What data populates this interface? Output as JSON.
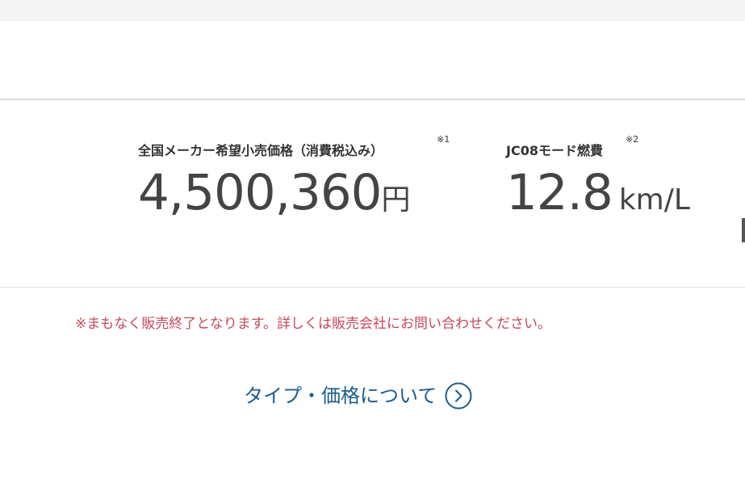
{
  "price": {
    "label": "全国メーカー希望小売価格（消費税込み）",
    "note": "※1",
    "value": "4,500,360",
    "unit": "円"
  },
  "fuel": {
    "label": "JC08モード燃費",
    "note": "※2",
    "value": "12.8",
    "unit": "km/L"
  },
  "notice": "※まもなく販売終了となります。詳しくは販売会社にお問い合わせください。",
  "type_price_link": {
    "label": "タイプ・価格について",
    "icon": "chevron-right-circle-icon"
  },
  "colors": {
    "notice": "#c8485a",
    "link": "#1a5d8f",
    "text": "#333333"
  }
}
